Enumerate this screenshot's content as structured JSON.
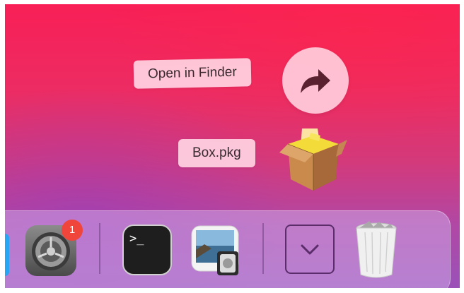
{
  "drag_menu": {
    "open_label": "Open in Finder",
    "file_label": "Box.pkg"
  },
  "icons": {
    "open_action": "curved-arrow-right-icon",
    "package": "package-box-icon"
  },
  "dock": {
    "items": [
      {
        "name": "System Preferences",
        "icon": "gear-icon",
        "badge": "1"
      },
      {
        "name": "Terminal",
        "icon": "terminal-icon",
        "prompt": ">_"
      },
      {
        "name": "Preview",
        "icon": "preview-icon"
      },
      {
        "name": "Downloads",
        "icon": "chevron-down-icon"
      },
      {
        "name": "Trash",
        "icon": "trash-icon"
      }
    ]
  },
  "colors": {
    "wallpaper_top": "#f81f56",
    "wallpaper_bottom": "#9a52b8",
    "badge": "#f0453a",
    "label_bg": "#ffd2e1"
  }
}
